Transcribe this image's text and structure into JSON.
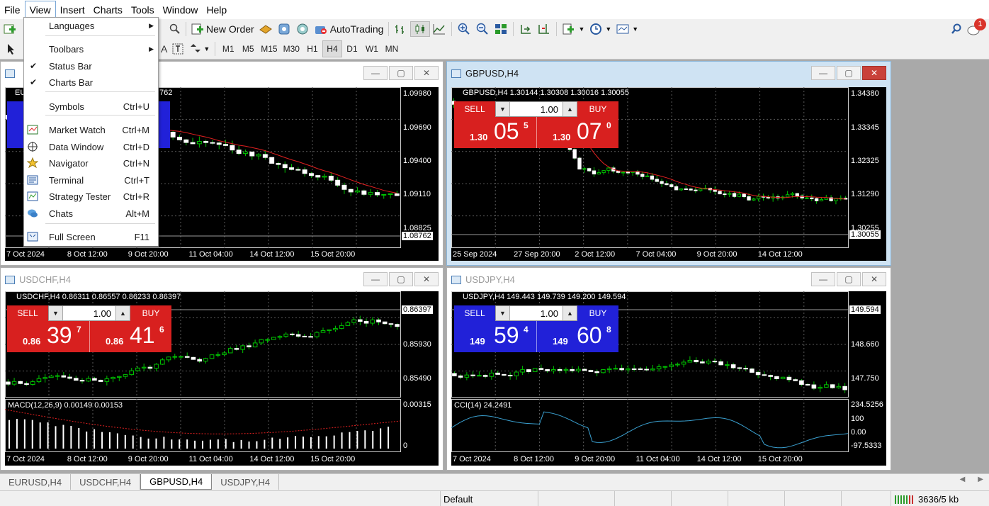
{
  "menubar": {
    "items": [
      "File",
      "View",
      "Insert",
      "Charts",
      "Tools",
      "Window",
      "Help"
    ]
  },
  "toolbar": {
    "new_order": "New Order",
    "autotrading": "AutoTrading",
    "notification_count": "1",
    "timeframes": [
      "M1",
      "M5",
      "M15",
      "M30",
      "H1",
      "H4",
      "D1",
      "W1",
      "MN"
    ],
    "active_timeframe": "H4"
  },
  "view_menu": {
    "items": [
      {
        "label": "Languages",
        "shortcut": "",
        "submenu": true,
        "checked": false,
        "icon": ""
      },
      {
        "label": "Toolbars",
        "shortcut": "",
        "submenu": true,
        "checked": false,
        "icon": ""
      },
      {
        "label": "Status Bar",
        "shortcut": "",
        "submenu": false,
        "checked": true,
        "icon": ""
      },
      {
        "label": "Charts Bar",
        "shortcut": "",
        "submenu": false,
        "checked": true,
        "icon": ""
      },
      {
        "label": "Symbols",
        "shortcut": "Ctrl+U",
        "submenu": false,
        "checked": false,
        "icon": ""
      },
      {
        "label": "Market Watch",
        "shortcut": "Ctrl+M",
        "submenu": false,
        "checked": false,
        "icon": "market-watch-icon"
      },
      {
        "label": "Data Window",
        "shortcut": "Ctrl+D",
        "submenu": false,
        "checked": false,
        "icon": "data-window-icon"
      },
      {
        "label": "Navigator",
        "shortcut": "Ctrl+N",
        "submenu": false,
        "checked": false,
        "icon": "navigator-icon"
      },
      {
        "label": "Terminal",
        "shortcut": "Ctrl+T",
        "submenu": false,
        "checked": false,
        "icon": "terminal-icon"
      },
      {
        "label": "Strategy Tester",
        "shortcut": "Ctrl+R",
        "submenu": false,
        "checked": false,
        "icon": "strategy-tester-icon"
      },
      {
        "label": "Chats",
        "shortcut": "Alt+M",
        "submenu": false,
        "checked": false,
        "icon": "chats-icon"
      },
      {
        "label": "Full Screen",
        "shortcut": "F11",
        "submenu": false,
        "checked": false,
        "icon": "full-screen-icon"
      }
    ]
  },
  "charts": [
    {
      "title": "",
      "header": "EU",
      "header_values": "762",
      "prices": [
        "1.09980",
        "1.09690",
        "1.09400",
        "1.09110",
        "1.08825"
      ],
      "current_price": "1.08762",
      "times": [
        "7 Oct 2024",
        "8 Oct 12:00",
        "9 Oct 20:00",
        "11 Oct 04:00",
        "14 Oct 12:00",
        "15 Oct 20:00"
      ]
    },
    {
      "title": "GBPUSD,H4",
      "header": "GBPUSD,H4  1.30144 1.30308 1.30016 1.30055",
      "prices": [
        "1.34380",
        "1.33345",
        "1.32325",
        "1.31290",
        "1.30255"
      ],
      "current_price": "1.30055",
      "times": [
        "25 Sep 2024",
        "27 Sep 20:00",
        "2 Oct 12:00",
        "7 Oct 04:00",
        "9 Oct 20:00",
        "14 Oct 12:00"
      ],
      "trade": {
        "sell": "SELL",
        "buy": "BUY",
        "lot": "1.00",
        "bid_small": "1.30",
        "bid_big": "05",
        "bid_sup": "5",
        "ask_small": "1.30",
        "ask_big": "07",
        "ask_sup": "0"
      }
    },
    {
      "title": "USDCHF,H4",
      "header": "USDCHF,H4  0.86311 0.86557 0.86233 0.86397",
      "prices": [
        "0.85930",
        "0.85490"
      ],
      "current_price": "0.86397",
      "sub_header": "MACD(12,26,9) 0.00149 0.00153",
      "sub_prices": [
        "0.00315",
        "0"
      ],
      "times": [
        "7 Oct 2024",
        "8 Oct 12:00",
        "9 Oct 20:00",
        "11 Oct 04:00",
        "14 Oct 12:00",
        "15 Oct 20:00"
      ],
      "trade": {
        "sell": "SELL",
        "buy": "BUY",
        "lot": "1.00",
        "bid_small": "0.86",
        "bid_big": "39",
        "bid_sup": "7",
        "ask_small": "0.86",
        "ask_big": "41",
        "ask_sup": "6"
      }
    },
    {
      "title": "USDJPY,H4",
      "header": "USDJPY,H4  149.443 149.739 149.200 149.594",
      "prices": [
        "148.660",
        "147.750"
      ],
      "current_price": "149.594",
      "sub_header": "CCI(14) 24.2491",
      "sub_prices": [
        "234.5256",
        "100",
        "0.00",
        "-97.5333"
      ],
      "times": [
        "7 Oct 2024",
        "8 Oct 12:00",
        "9 Oct 20:00",
        "11 Oct 04:00",
        "14 Oct 12:00",
        "15 Oct 20:00"
      ],
      "trade": {
        "sell": "SELL",
        "buy": "BUY",
        "lot": "1.00",
        "bid_small": "149",
        "bid_big": "59",
        "bid_sup": "4",
        "ask_small": "149",
        "ask_big": "60",
        "ask_sup": "8"
      }
    }
  ],
  "tabs": [
    "EURUSD,H4",
    "USDCHF,H4",
    "GBPUSD,H4",
    "USDJPY,H4"
  ],
  "active_tab": "GBPUSD,H4",
  "status": {
    "profile": "Default",
    "traffic": "3636/5 kb"
  },
  "colors": {
    "sell_red": "#d8201f",
    "buy_blue": "#2121d8",
    "bull_candle": "#ffffff",
    "bear_candle": "#ffffff",
    "wick": "#00c000",
    "ma_line": "#e02020",
    "cci_line": "#3aa0d0"
  }
}
